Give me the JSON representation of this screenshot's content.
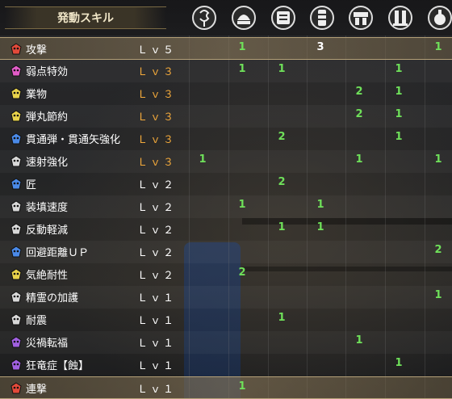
{
  "header": {
    "title": "発動スキル",
    "columns": [
      {
        "icon": "charm-icon"
      },
      {
        "icon": "helm-icon"
      },
      {
        "icon": "chest-armor-icon"
      },
      {
        "icon": "arm-armor-icon"
      },
      {
        "icon": "waist-armor-icon"
      },
      {
        "icon": "leg-armor-icon"
      },
      {
        "icon": "talisman-icon"
      }
    ]
  },
  "colors": {
    "value_green": "#6fe05a",
    "value_white": "#ffffff",
    "level_orange": "#f2a93b"
  },
  "skills": [
    {
      "name": "攻撃",
      "level": "Ｌｖ５",
      "level_color": "white",
      "icon_color": "#e24a3a",
      "values": [
        "",
        "1",
        "",
        "3",
        "",
        "",
        "1"
      ],
      "highlight": true
    },
    {
      "name": "弱点特効",
      "level": "Ｌｖ３",
      "level_color": "orange",
      "icon_color": "#e25cc8",
      "values": [
        "",
        "1",
        "1",
        "",
        "",
        "1",
        ""
      ]
    },
    {
      "name": "業物",
      "level": "Ｌｖ３",
      "level_color": "orange",
      "icon_color": "#e8d24a",
      "values": [
        "",
        "",
        "",
        "",
        "2",
        "1",
        ""
      ]
    },
    {
      "name": "弾丸節約",
      "level": "Ｌｖ３",
      "level_color": "orange",
      "icon_color": "#e8d24a",
      "values": [
        "",
        "",
        "",
        "",
        "2",
        "1",
        ""
      ]
    },
    {
      "name": "貫通弾・貫通矢強化",
      "level": "Ｌｖ３",
      "level_color": "orange",
      "icon_color": "#4a8ae8",
      "values": [
        "",
        "",
        "2",
        "",
        "",
        "1",
        ""
      ]
    },
    {
      "name": "速射強化",
      "level": "Ｌｖ３",
      "level_color": "orange",
      "icon_color": "#d8d8d8",
      "values": [
        "1",
        "",
        "",
        "",
        "1",
        "",
        "1"
      ]
    },
    {
      "name": "匠",
      "level": "Ｌｖ２",
      "level_color": "white",
      "icon_color": "#4a8ae8",
      "values": [
        "",
        "",
        "2",
        "",
        "",
        "",
        ""
      ]
    },
    {
      "name": "装填速度",
      "level": "Ｌｖ２",
      "level_color": "white",
      "icon_color": "#d8d8d8",
      "values": [
        "",
        "1",
        "",
        "1",
        "",
        "",
        ""
      ]
    },
    {
      "name": "反動軽減",
      "level": "Ｌｖ２",
      "level_color": "white",
      "icon_color": "#d8d8d8",
      "values": [
        "",
        "",
        "1",
        "1",
        "",
        "",
        ""
      ]
    },
    {
      "name": "回避距離ＵＰ",
      "level": "Ｌｖ２",
      "level_color": "white",
      "icon_color": "#4a8ae8",
      "values": [
        "",
        "",
        "",
        "",
        "",
        "",
        "2"
      ]
    },
    {
      "name": "気絶耐性",
      "level": "Ｌｖ２",
      "level_color": "white",
      "icon_color": "#e8d24a",
      "values": [
        "",
        "2",
        "",
        "",
        "",
        "",
        ""
      ]
    },
    {
      "name": "精霊の加護",
      "level": "Ｌｖ１",
      "level_color": "white",
      "icon_color": "#d8d8d8",
      "values": [
        "",
        "",
        "",
        "",
        "",
        "",
        "1"
      ]
    },
    {
      "name": "耐震",
      "level": "Ｌｖ１",
      "level_color": "white",
      "icon_color": "#d8d8d8",
      "values": [
        "",
        "",
        "1",
        "",
        "",
        "",
        ""
      ]
    },
    {
      "name": "災禍転福",
      "level": "Ｌｖ１",
      "level_color": "white",
      "icon_color": "#a060e0",
      "values": [
        "",
        "",
        "",
        "",
        "1",
        "",
        ""
      ]
    },
    {
      "name": "狂竜症【蝕】",
      "level": "Ｌｖ１",
      "level_color": "white",
      "icon_color": "#a060e0",
      "values": [
        "",
        "",
        "",
        "",
        "",
        "1",
        ""
      ]
    },
    {
      "name": "連撃",
      "level": "Ｌｖ１",
      "level_color": "white",
      "icon_color": "#e24a3a",
      "values": [
        "",
        "1",
        "",
        "",
        "",
        "",
        ""
      ],
      "highlight": true
    }
  ]
}
